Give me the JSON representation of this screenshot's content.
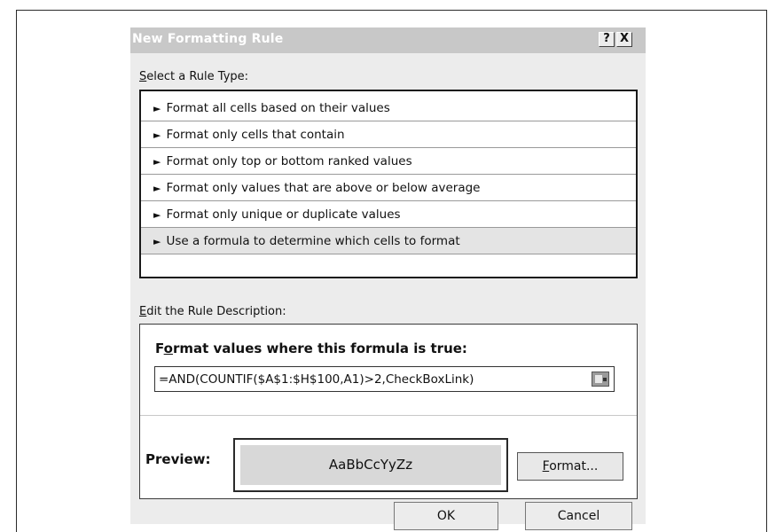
{
  "dialog": {
    "title": "New Formatting Rule",
    "help_label": "?",
    "close_label": "X"
  },
  "rule_type": {
    "label": "Select a Rule Type:",
    "items": [
      {
        "label": "Format all cells based on their values",
        "selected": false
      },
      {
        "label": "Format only cells that contain",
        "selected": false
      },
      {
        "label": "Format only top or bottom ranked values",
        "selected": false
      },
      {
        "label": "Format only values that are above or below average",
        "selected": false
      },
      {
        "label": "Format only unique or duplicate values",
        "selected": false
      },
      {
        "label": "Use a formula to determine which cells to format",
        "selected": true
      }
    ],
    "arrow_glyph": "►"
  },
  "description": {
    "label": "Edit the Rule Description:",
    "formula_heading": "Format values where this formula is true:",
    "formula_value": "=AND(COUNTIF($A$1:$H$100,A1)>2,CheckBoxLink)",
    "collapse_icon": "range-selector-icon"
  },
  "preview": {
    "label": "Preview:",
    "sample_text": "AaBbCcYyZz",
    "format_button_label": "Format..."
  },
  "buttons": {
    "ok_label": "OK",
    "cancel_label": "Cancel"
  }
}
